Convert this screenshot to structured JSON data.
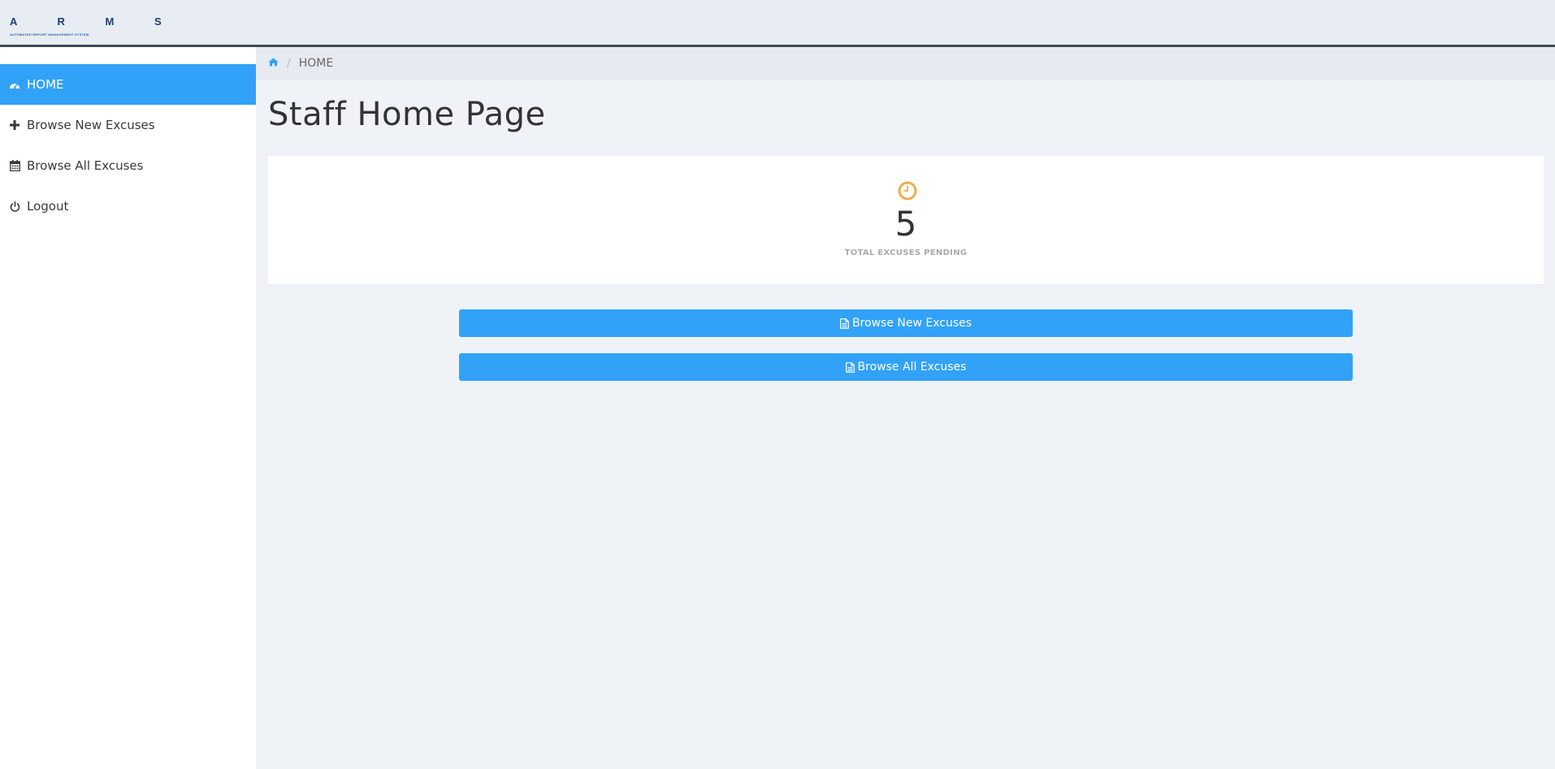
{
  "brand": {
    "letters": "A R M S",
    "subtitle": "AUTOMATED REPORT MANAGEMENT SYSTEM"
  },
  "sidebar": {
    "items": [
      {
        "label": "HOME",
        "icon": "dashboard-icon",
        "active": true
      },
      {
        "label": "Browse New Excuses",
        "icon": "plus-icon"
      },
      {
        "label": "Browse All Excuses",
        "icon": "calendar-icon"
      },
      {
        "label": "Logout",
        "icon": "power-icon"
      }
    ]
  },
  "breadcrumb": {
    "home_icon": "home-icon",
    "separator": "/",
    "current": "HOME"
  },
  "page": {
    "title": "Staff Home Page"
  },
  "stat": {
    "icon": "clock-icon",
    "value": "5",
    "label": "TOTAL EXCUSES PENDING"
  },
  "buttons": {
    "browse_new": "Browse New Excuses",
    "browse_all": "Browse All Excuses"
  },
  "colors": {
    "accent": "#31a2f8",
    "clock": "#f0ad4e",
    "topbar_border": "#3f4a56"
  }
}
